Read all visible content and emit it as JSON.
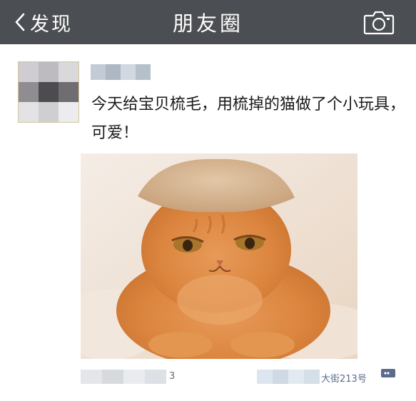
{
  "header": {
    "back_label": "发现",
    "title": "朋友圈",
    "camera_icon": "camera-icon",
    "bg_color": "#4b4e52"
  },
  "post": {
    "text": "今天给宝贝梳毛，用梳掉的猫做了个小玩具，\n可爱！",
    "photo_description_icon": "photo",
    "footer": {
      "time_suffix": "3",
      "location": "大街213号"
    },
    "comment_icon": "comment-bubble-icon",
    "link_color": "#5b6b8c"
  }
}
